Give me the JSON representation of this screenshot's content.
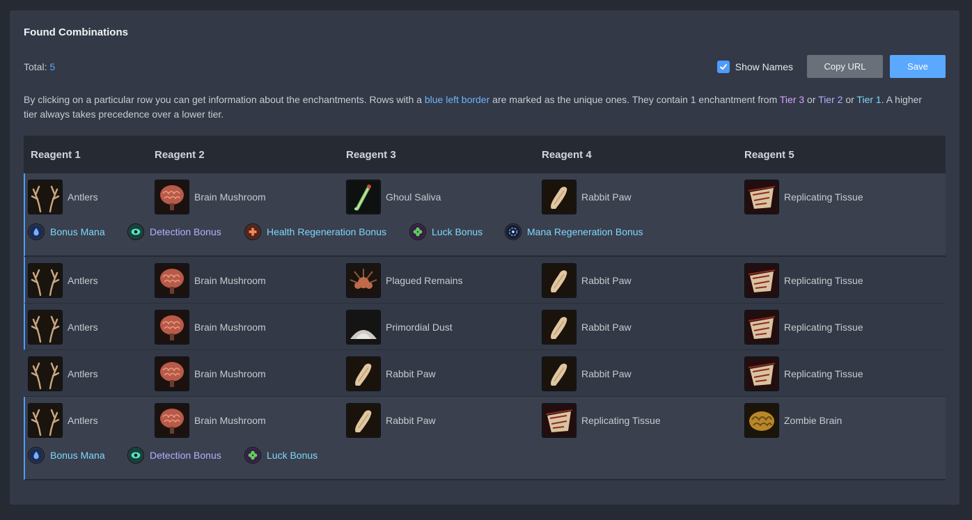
{
  "panel": {
    "title": "Found Combinations",
    "total_label": "Total:",
    "total_value": "5",
    "show_names_label": "Show Names",
    "copy_url_label": "Copy URL",
    "save_label": "Save",
    "desc": {
      "p1": "By clicking on a particular row you can get information about the enchantments. Rows with a ",
      "blue_border": "blue left border",
      "p2": " are marked as the unique ones. They contain 1 enchantment from ",
      "tier3": "Tier 3",
      "or1": " or ",
      "tier2": "Tier 2",
      "or2": " or ",
      "tier1": "Tier 1",
      "p3": ". A higher tier always takes precedence over a lower tier."
    }
  },
  "table": {
    "headers": [
      "Reagent 1",
      "Reagent 2",
      "Reagent 3",
      "Reagent 4",
      "Reagent 5"
    ],
    "rows": [
      {
        "reagents": [
          "Antlers",
          "Brain Mushroom",
          "Ghoul Saliva",
          "Rabbit Paw",
          "Replicating Tissue"
        ],
        "enchantments": [
          "Bonus Mana",
          "Detection Bonus",
          "Health Regeneration Bonus",
          "Luck Bonus",
          "Mana Regeneration Bonus"
        ]
      },
      {
        "reagents": [
          "Antlers",
          "Brain Mushroom",
          "Plagued Remains",
          "Rabbit Paw",
          "Replicating Tissue"
        ]
      },
      {
        "reagents": [
          "Antlers",
          "Brain Mushroom",
          "Primordial Dust",
          "Rabbit Paw",
          "Replicating Tissue"
        ]
      },
      {
        "reagents": [
          "Antlers",
          "Brain Mushroom",
          "Rabbit Paw",
          "Rabbit Paw",
          "Replicating Tissue"
        ]
      },
      {
        "reagents": [
          "Antlers",
          "Brain Mushroom",
          "Rabbit Paw",
          "Replicating Tissue",
          "Zombie Brain"
        ],
        "enchantments": [
          "Bonus Mana",
          "Detection Bonus",
          "Luck Bonus"
        ]
      }
    ]
  },
  "icons": {
    "Antlers": "antlers-icon",
    "Brain Mushroom": "brain-mushroom-icon",
    "Ghoul Saliva": "ghoul-saliva-icon",
    "Rabbit Paw": "rabbit-paw-icon",
    "Replicating Tissue": "replicating-tissue-icon",
    "Plagued Remains": "plagued-remains-icon",
    "Primordial Dust": "primordial-dust-icon",
    "Zombie Brain": "zombie-brain-icon",
    "Bonus Mana": "bonus-mana-icon",
    "Detection Bonus": "detection-bonus-icon",
    "Health Regeneration Bonus": "health-regeneration-icon",
    "Luck Bonus": "luck-bonus-icon",
    "Mana Regeneration Bonus": "mana-regeneration-icon"
  },
  "colors": {
    "accent": "#5aa9ff",
    "panel_bg": "#333946",
    "page_bg": "#252a33",
    "tier1": "#7fd8ff",
    "tier2": "#b7b0ff",
    "tier3": "#d7a4ff"
  }
}
